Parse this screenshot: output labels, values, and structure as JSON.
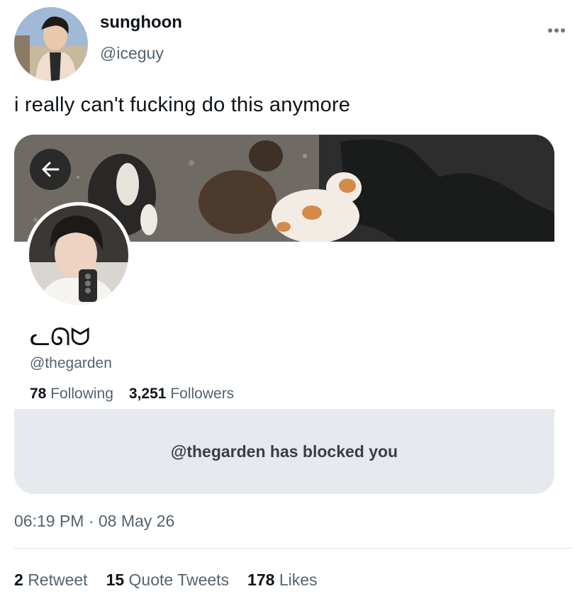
{
  "author": {
    "name": "sunghoon",
    "handle": "@iceguy"
  },
  "tweet": {
    "text": "i really can't fucking do this anymore",
    "timestamp": "06:19 PM · 08 May 26"
  },
  "profile_card": {
    "display_name": "ᓚᘏᗢ",
    "handle": "@thegarden",
    "following_count": "78",
    "following_label": "Following",
    "followers_count": "3,251",
    "followers_label": "Followers",
    "blocked_message": "@thegarden has blocked you"
  },
  "engagement": {
    "retweets_count": "2",
    "retweets_label": "Retweet",
    "quotes_count": "15",
    "quotes_label": "Quote Tweets",
    "likes_count": "178",
    "likes_label": "Likes"
  },
  "icons": {
    "more": "more-horizontal-icon",
    "back": "arrow-left-icon"
  },
  "colors": {
    "secondary_text": "#536471",
    "primary_text": "#0f1419",
    "blocked_panel_bg": "#e6e9ee"
  }
}
